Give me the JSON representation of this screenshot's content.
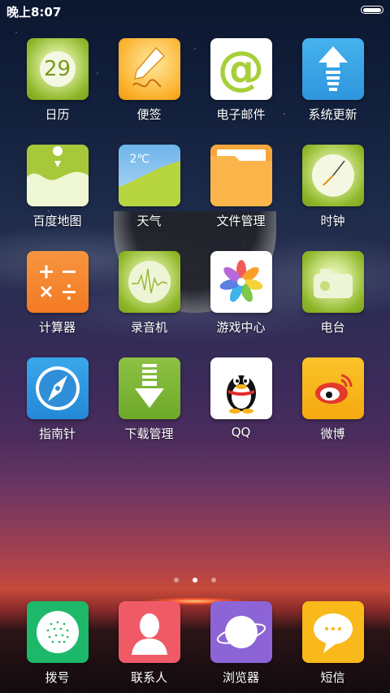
{
  "status_bar": {
    "time": "晚上8:07"
  },
  "apps": [
    {
      "label": "日历",
      "icon": "calendar-icon",
      "day": "29"
    },
    {
      "label": "便签",
      "icon": "notes-icon"
    },
    {
      "label": "电子邮件",
      "icon": "email-icon",
      "glyph": "@"
    },
    {
      "label": "系统更新",
      "icon": "system-update-icon"
    },
    {
      "label": "百度地图",
      "icon": "map-icon"
    },
    {
      "label": "天气",
      "icon": "weather-icon",
      "temp": "2℃"
    },
    {
      "label": "文件管理",
      "icon": "folder-icon"
    },
    {
      "label": "时钟",
      "icon": "clock-icon"
    },
    {
      "label": "计算器",
      "icon": "calculator-icon",
      "ops": "+ −\n× ÷"
    },
    {
      "label": "录音机",
      "icon": "recorder-icon"
    },
    {
      "label": "游戏中心",
      "icon": "game-center-icon"
    },
    {
      "label": "电台",
      "icon": "radio-icon"
    },
    {
      "label": "指南针",
      "icon": "compass-icon"
    },
    {
      "label": "下载管理",
      "icon": "download-icon"
    },
    {
      "label": "QQ",
      "icon": "qq-penguin-icon"
    },
    {
      "label": "微博",
      "icon": "weibo-icon"
    }
  ],
  "page_indicator": {
    "count": 3,
    "active_index": 1
  },
  "dock": [
    {
      "label": "拨号",
      "icon": "dialer-icon"
    },
    {
      "label": "联系人",
      "icon": "contacts-icon"
    },
    {
      "label": "浏览器",
      "icon": "browser-icon"
    },
    {
      "label": "短信",
      "icon": "messages-icon"
    }
  ],
  "colors": {
    "green_tile": "#8fb72a",
    "orange_tile": "#fbb22d",
    "blue_tile": "#33a3e6",
    "calc_orange": "#f5822a",
    "dialer_green": "#1db86a",
    "contacts_red": "#f05a67",
    "browser_purple": "#8c64d6",
    "sms_yellow": "#f9b91a"
  }
}
